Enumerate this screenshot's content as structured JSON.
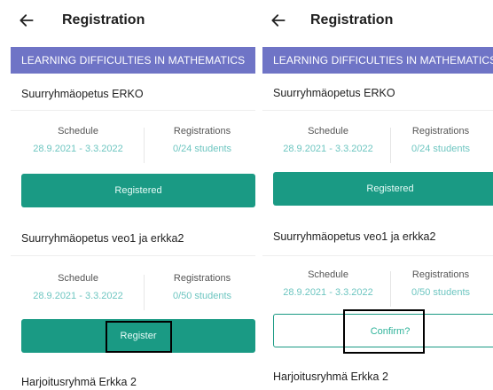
{
  "screens": [
    {
      "title": "Registration",
      "section": "LEARNING DIFFICULTIES IN MATHEMATICS",
      "courses": [
        {
          "name": "Suurryhmäopetus ERKO",
          "schedule_label": "Schedule",
          "schedule": "28.9.2021 - 3.3.2022",
          "registrations_label": "Registrations",
          "registrations": "0/24 students",
          "button_label": "Registered"
        },
        {
          "name": "Suurryhmäopetus veo1 ja erkka2",
          "schedule_label": "Schedule",
          "schedule": "28.9.2021 - 3.3.2022",
          "registrations_label": "Registrations",
          "registrations": "0/50 students",
          "button_label": "Register"
        }
      ],
      "next_course": "Harjoitusryhmä Erkka 2"
    },
    {
      "title": "Registration",
      "section": "LEARNING DIFFICULTIES IN MATHEMATICS",
      "courses": [
        {
          "name": "Suurryhmäopetus ERKO",
          "schedule_label": "Schedule",
          "schedule": "28.9.2021 - 3.3.2022",
          "registrations_label": "Registrations",
          "registrations": "0/24 students",
          "button_label": "Registered"
        },
        {
          "name": "Suurryhmäopetus veo1 ja erkka2",
          "schedule_label": "Schedule",
          "schedule": "28.9.2021 - 3.3.2022",
          "registrations_label": "Registrations",
          "registrations": "0/50 students",
          "button_label": "Confirm?"
        }
      ],
      "next_course": "Harjoitusryhmä Erkka 2"
    }
  ],
  "colors": {
    "section_bar": "#6f74c6",
    "primary": "#1a9a84",
    "value_text": "#6ec6c1",
    "highlight": "#000000"
  },
  "icons": {
    "back": "arrow-left-icon"
  }
}
